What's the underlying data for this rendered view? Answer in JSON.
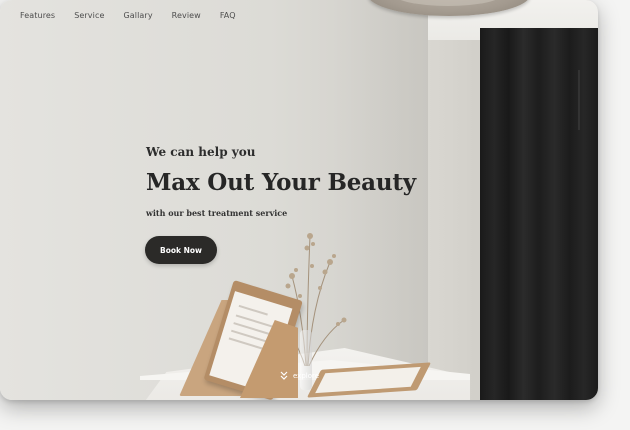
{
  "nav": {
    "items": [
      "Features",
      "Service",
      "Gallary",
      "Review",
      "FAQ"
    ]
  },
  "hero": {
    "eyebrow": "We can help you",
    "headline": "Max Out Your Beauty",
    "subline": "with our best treatment service",
    "cta_label": "Book Now"
  },
  "explore": {
    "label": "explore",
    "icon": "double-chevron-down-icon"
  },
  "colors": {
    "cta_background": "#2b2a28",
    "text_dark": "#262626",
    "curtain": "#1f1f1f",
    "wall": "#dcdbd6"
  }
}
